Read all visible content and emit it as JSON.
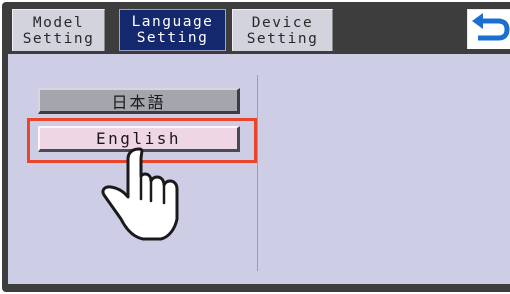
{
  "tabs": [
    {
      "line1": "Model",
      "line2": "Setting"
    },
    {
      "line1": "Language",
      "line2": "Setting"
    },
    {
      "line1": "Device",
      "line2": "Setting"
    }
  ],
  "active_tab": "Language Setting",
  "back_button": {
    "icon": "back-arrow-icon",
    "color": "#1a6fd0"
  },
  "languages": [
    {
      "label": "日本語",
      "selected": false
    },
    {
      "label": "English",
      "selected": true
    }
  ],
  "highlight_color": "#e8452c",
  "pointer": {
    "icon": "pointing-hand-icon"
  }
}
